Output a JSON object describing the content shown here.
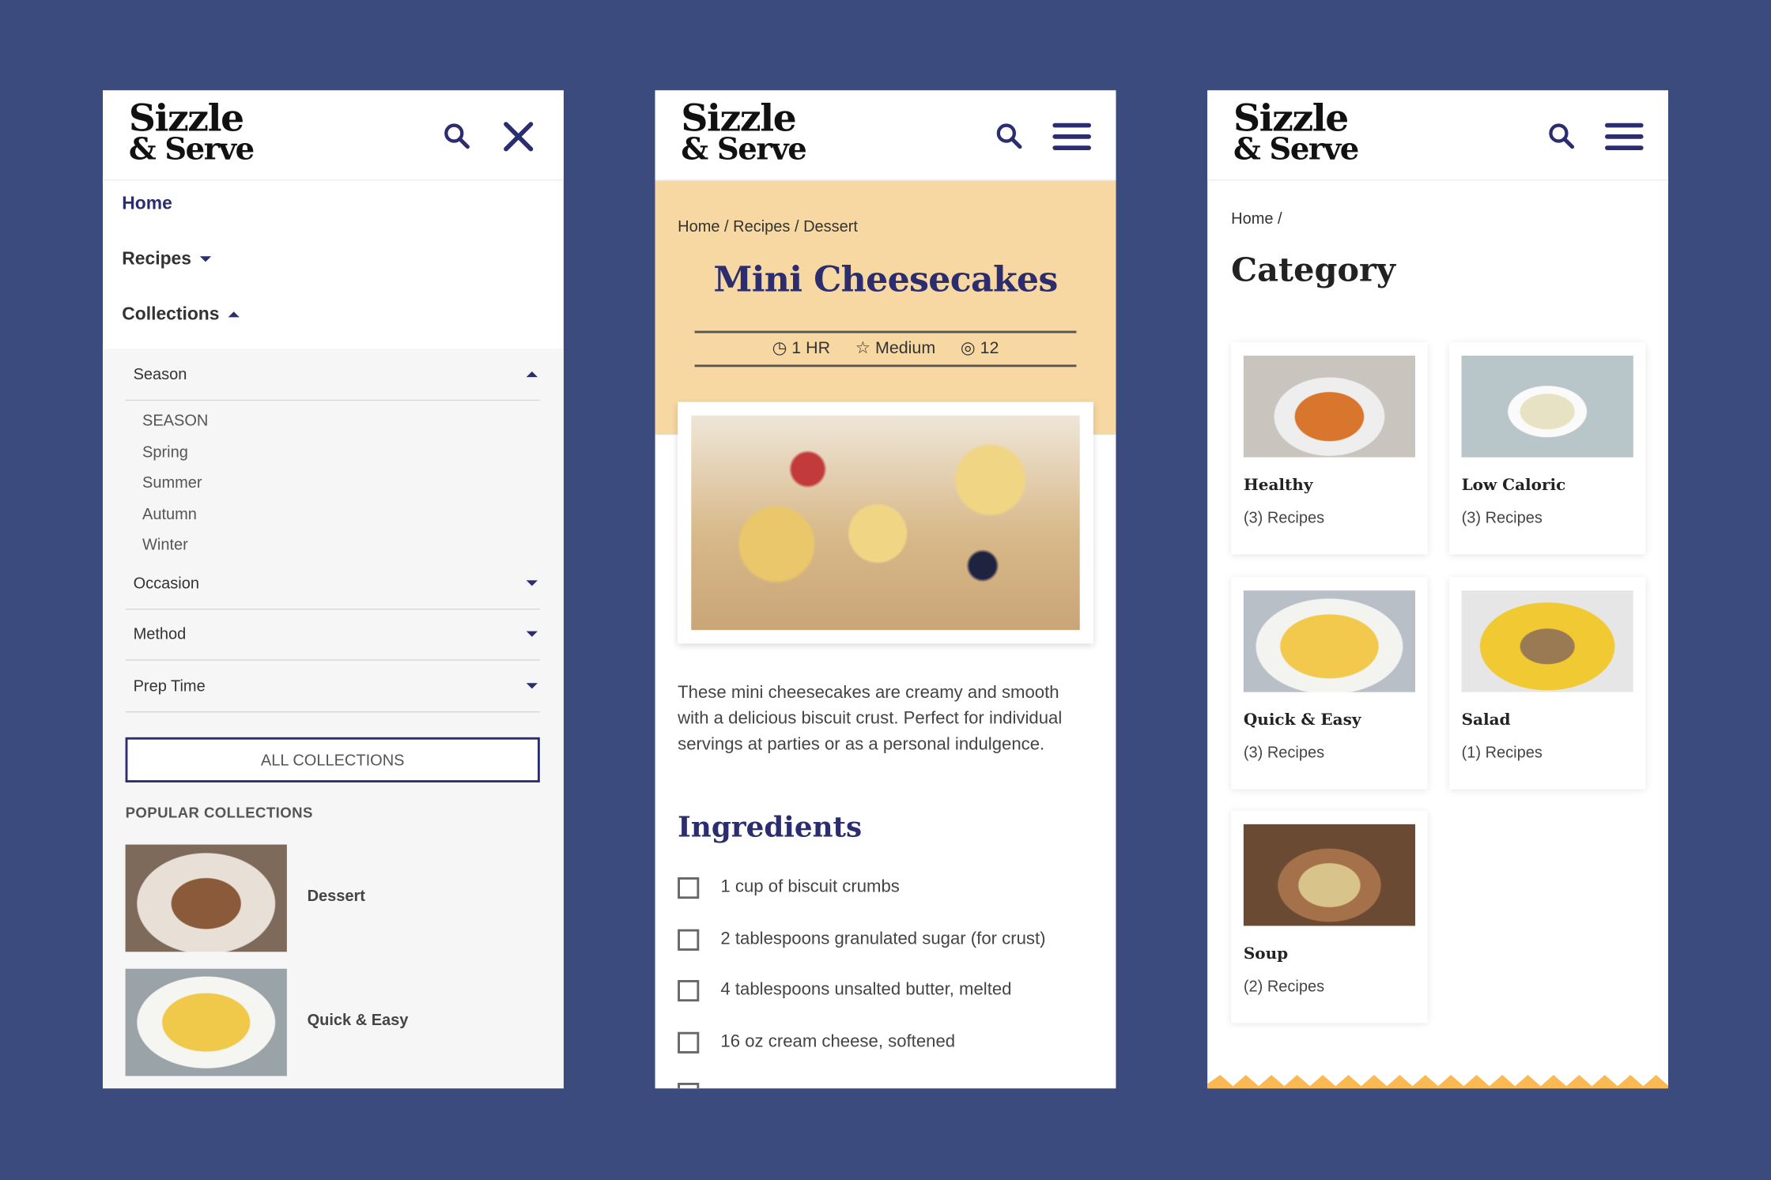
{
  "brand": {
    "line1": "Sizzle",
    "line2": "& Serve",
    "accent": "#2b2d6e",
    "tan": "#f8d8a2",
    "zigzag": "#fbb954",
    "background": "#3c4b7e"
  },
  "menu_panel": {
    "nav": [
      {
        "label": "Home"
      },
      {
        "label": "Recipes"
      },
      {
        "label": "Collections"
      }
    ],
    "accordions": [
      {
        "label": "Season",
        "expanded": true,
        "items": [
          "SEASON",
          "Spring",
          "Summer",
          "Autumn",
          "Winter"
        ]
      },
      {
        "label": "Occasion",
        "expanded": false
      },
      {
        "label": "Method",
        "expanded": false
      },
      {
        "label": "Prep Time",
        "expanded": false
      }
    ],
    "all_collections": "ALL COLLECTIONS",
    "popular_label": "POPULAR COLLECTIONS",
    "popular": [
      {
        "label": "Dessert"
      },
      {
        "label": "Quick & Easy"
      }
    ]
  },
  "recipe_panel": {
    "breadcrumb": "Home / Recipes / Dessert",
    "title": "Mini Cheesecakes",
    "meta": {
      "time": "1 HR",
      "difficulty": "Medium",
      "servings": "12"
    },
    "description": "These mini cheesecakes are creamy and smooth with a delicious biscuit crust. Perfect for individual servings at parties or as a personal indulgence.",
    "ingredients_heading": "Ingredients",
    "ingredients": [
      "1 cup of biscuit crumbs",
      "2 tablespoons granulated sugar (for crust)",
      "4 tablespoons unsalted butter, melted",
      "16 oz cream cheese, softened"
    ]
  },
  "category_panel": {
    "breadcrumb": "Home /",
    "title": "Category",
    "cards": [
      {
        "title": "Healthy",
        "count": "(3) Recipes"
      },
      {
        "title": "Low Caloric",
        "count": "(3) Recipes"
      },
      {
        "title": "Quick & Easy",
        "count": "(3) Recipes"
      },
      {
        "title": "Salad",
        "count": "(1) Recipes"
      },
      {
        "title": "Soup",
        "count": "(2) Recipes"
      }
    ]
  }
}
